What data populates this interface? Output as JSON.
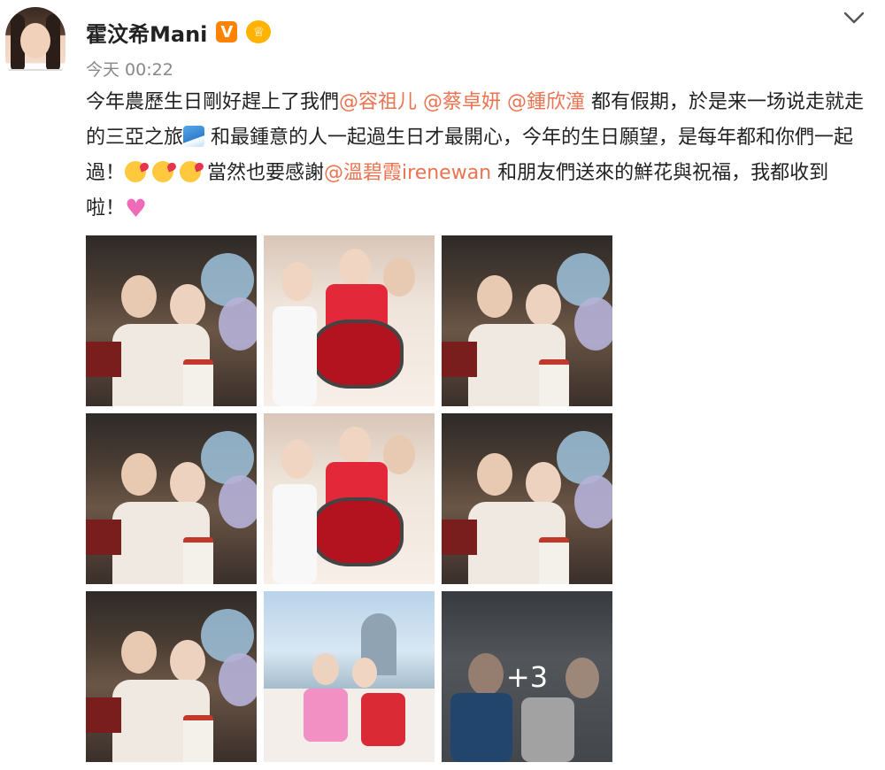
{
  "post": {
    "author": "霍汶希Mani",
    "verified_badge": "V",
    "time": "今天 00:22",
    "text_segments": [
      {
        "type": "text",
        "value": "今年農歷生日剛好趕上了我們"
      },
      {
        "type": "mention",
        "value": "@容祖儿"
      },
      {
        "type": "text",
        "value": " "
      },
      {
        "type": "mention",
        "value": "@蔡卓妍"
      },
      {
        "type": "text",
        "value": " "
      },
      {
        "type": "mention",
        "value": "@鍾欣潼"
      },
      {
        "type": "text",
        "value": " 都有假期，於是来一场说走就走的三亞之旅"
      },
      {
        "type": "emoji",
        "value": "wave"
      },
      {
        "type": "text",
        "value": " 和最鍾意的人一起過生日才最開心，今年的生日願望，是每年都和你們一起過！"
      },
      {
        "type": "emoji",
        "value": "kiss"
      },
      {
        "type": "text",
        "value": " "
      },
      {
        "type": "emoji",
        "value": "kiss"
      },
      {
        "type": "text",
        "value": " "
      },
      {
        "type": "emoji",
        "value": "kiss"
      },
      {
        "type": "text",
        "value": " 當然也要感謝"
      },
      {
        "type": "mention",
        "value": "@溫碧霞irenewan"
      },
      {
        "type": "text",
        "value": " 和朋友們送來的鮮花與祝福，我都收到啦！"
      },
      {
        "type": "emoji",
        "value": "heart"
      }
    ],
    "images": [
      {
        "scene": "indoor"
      },
      {
        "scene": "red"
      },
      {
        "scene": "indoor"
      },
      {
        "scene": "indoor"
      },
      {
        "scene": "red"
      },
      {
        "scene": "indoor"
      },
      {
        "scene": "indoor"
      },
      {
        "scene": "out"
      },
      {
        "scene": "dusk",
        "overlay": "+3"
      }
    ]
  },
  "colors": {
    "mention": "#eb7350",
    "badge_orange": "#ff8200",
    "text": "#222222",
    "meta": "#888888"
  }
}
